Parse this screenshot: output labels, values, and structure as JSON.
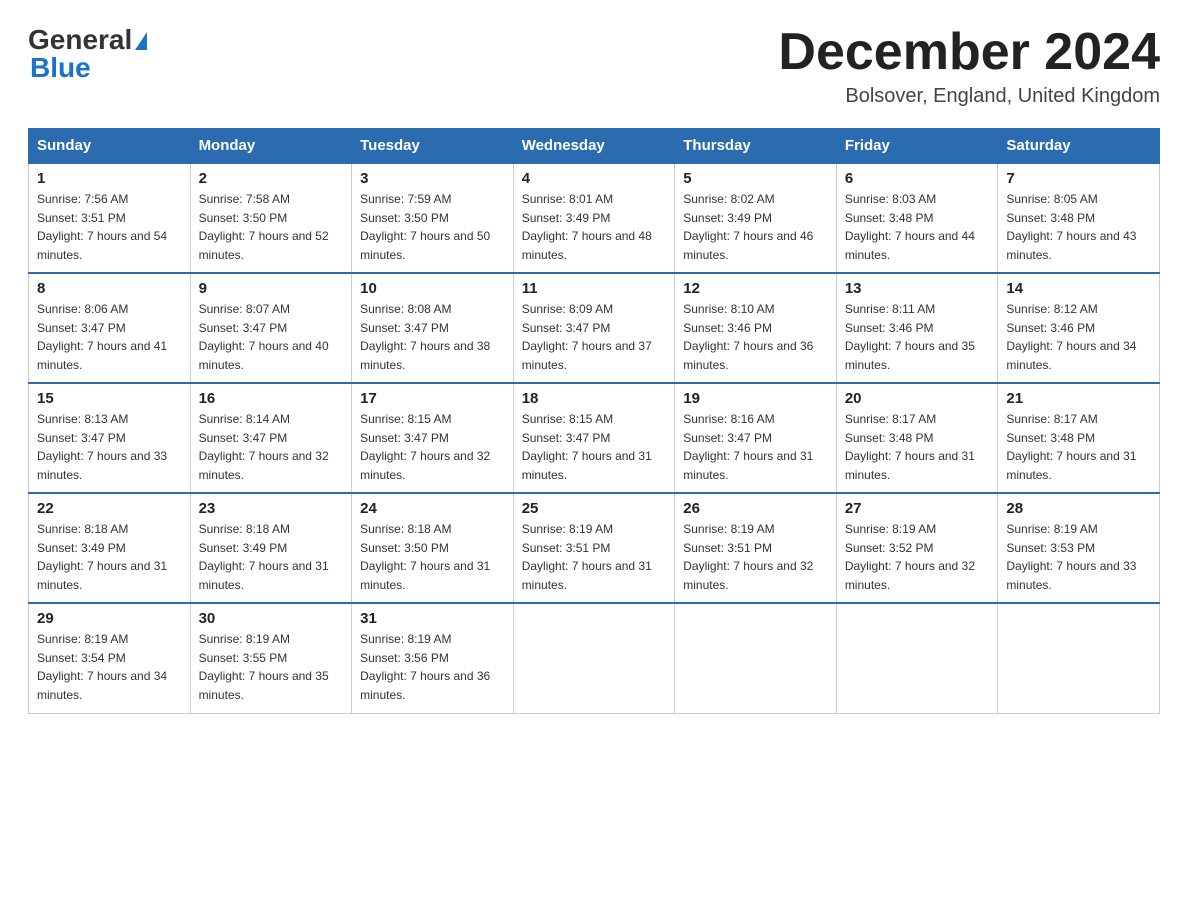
{
  "header": {
    "logo_general": "General",
    "logo_blue": "Blue",
    "month_title": "December 2024",
    "location": "Bolsover, England, United Kingdom"
  },
  "days_of_week": [
    "Sunday",
    "Monday",
    "Tuesday",
    "Wednesday",
    "Thursday",
    "Friday",
    "Saturday"
  ],
  "weeks": [
    [
      {
        "day": "1",
        "sunrise": "7:56 AM",
        "sunset": "3:51 PM",
        "daylight": "7 hours and 54 minutes."
      },
      {
        "day": "2",
        "sunrise": "7:58 AM",
        "sunset": "3:50 PM",
        "daylight": "7 hours and 52 minutes."
      },
      {
        "day": "3",
        "sunrise": "7:59 AM",
        "sunset": "3:50 PM",
        "daylight": "7 hours and 50 minutes."
      },
      {
        "day": "4",
        "sunrise": "8:01 AM",
        "sunset": "3:49 PM",
        "daylight": "7 hours and 48 minutes."
      },
      {
        "day": "5",
        "sunrise": "8:02 AM",
        "sunset": "3:49 PM",
        "daylight": "7 hours and 46 minutes."
      },
      {
        "day": "6",
        "sunrise": "8:03 AM",
        "sunset": "3:48 PM",
        "daylight": "7 hours and 44 minutes."
      },
      {
        "day": "7",
        "sunrise": "8:05 AM",
        "sunset": "3:48 PM",
        "daylight": "7 hours and 43 minutes."
      }
    ],
    [
      {
        "day": "8",
        "sunrise": "8:06 AM",
        "sunset": "3:47 PM",
        "daylight": "7 hours and 41 minutes."
      },
      {
        "day": "9",
        "sunrise": "8:07 AM",
        "sunset": "3:47 PM",
        "daylight": "7 hours and 40 minutes."
      },
      {
        "day": "10",
        "sunrise": "8:08 AM",
        "sunset": "3:47 PM",
        "daylight": "7 hours and 38 minutes."
      },
      {
        "day": "11",
        "sunrise": "8:09 AM",
        "sunset": "3:47 PM",
        "daylight": "7 hours and 37 minutes."
      },
      {
        "day": "12",
        "sunrise": "8:10 AM",
        "sunset": "3:46 PM",
        "daylight": "7 hours and 36 minutes."
      },
      {
        "day": "13",
        "sunrise": "8:11 AM",
        "sunset": "3:46 PM",
        "daylight": "7 hours and 35 minutes."
      },
      {
        "day": "14",
        "sunrise": "8:12 AM",
        "sunset": "3:46 PM",
        "daylight": "7 hours and 34 minutes."
      }
    ],
    [
      {
        "day": "15",
        "sunrise": "8:13 AM",
        "sunset": "3:47 PM",
        "daylight": "7 hours and 33 minutes."
      },
      {
        "day": "16",
        "sunrise": "8:14 AM",
        "sunset": "3:47 PM",
        "daylight": "7 hours and 32 minutes."
      },
      {
        "day": "17",
        "sunrise": "8:15 AM",
        "sunset": "3:47 PM",
        "daylight": "7 hours and 32 minutes."
      },
      {
        "day": "18",
        "sunrise": "8:15 AM",
        "sunset": "3:47 PM",
        "daylight": "7 hours and 31 minutes."
      },
      {
        "day": "19",
        "sunrise": "8:16 AM",
        "sunset": "3:47 PM",
        "daylight": "7 hours and 31 minutes."
      },
      {
        "day": "20",
        "sunrise": "8:17 AM",
        "sunset": "3:48 PM",
        "daylight": "7 hours and 31 minutes."
      },
      {
        "day": "21",
        "sunrise": "8:17 AM",
        "sunset": "3:48 PM",
        "daylight": "7 hours and 31 minutes."
      }
    ],
    [
      {
        "day": "22",
        "sunrise": "8:18 AM",
        "sunset": "3:49 PM",
        "daylight": "7 hours and 31 minutes."
      },
      {
        "day": "23",
        "sunrise": "8:18 AM",
        "sunset": "3:49 PM",
        "daylight": "7 hours and 31 minutes."
      },
      {
        "day": "24",
        "sunrise": "8:18 AM",
        "sunset": "3:50 PM",
        "daylight": "7 hours and 31 minutes."
      },
      {
        "day": "25",
        "sunrise": "8:19 AM",
        "sunset": "3:51 PM",
        "daylight": "7 hours and 31 minutes."
      },
      {
        "day": "26",
        "sunrise": "8:19 AM",
        "sunset": "3:51 PM",
        "daylight": "7 hours and 32 minutes."
      },
      {
        "day": "27",
        "sunrise": "8:19 AM",
        "sunset": "3:52 PM",
        "daylight": "7 hours and 32 minutes."
      },
      {
        "day": "28",
        "sunrise": "8:19 AM",
        "sunset": "3:53 PM",
        "daylight": "7 hours and 33 minutes."
      }
    ],
    [
      {
        "day": "29",
        "sunrise": "8:19 AM",
        "sunset": "3:54 PM",
        "daylight": "7 hours and 34 minutes."
      },
      {
        "day": "30",
        "sunrise": "8:19 AM",
        "sunset": "3:55 PM",
        "daylight": "7 hours and 35 minutes."
      },
      {
        "day": "31",
        "sunrise": "8:19 AM",
        "sunset": "3:56 PM",
        "daylight": "7 hours and 36 minutes."
      },
      null,
      null,
      null,
      null
    ]
  ]
}
